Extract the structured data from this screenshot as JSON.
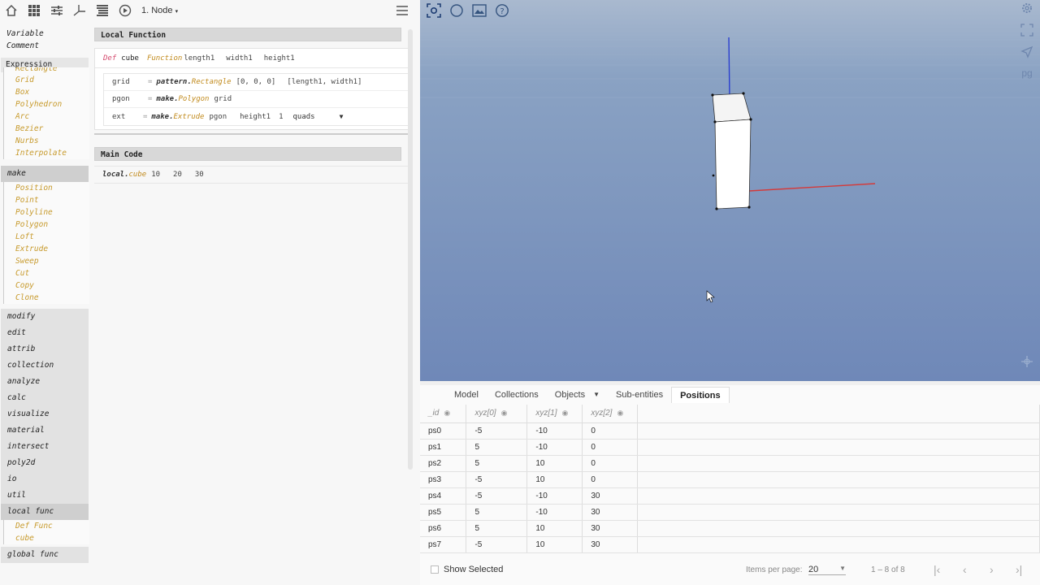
{
  "toolbar": {
    "node_label": "1. Node",
    "icons": [
      "home-icon",
      "grid-icon",
      "sliders-icon",
      "axes-icon",
      "list-icon",
      "play-icon",
      "hamburger-icon"
    ]
  },
  "sidebar": {
    "top_items": [
      "Variable",
      "Comment"
    ],
    "expression_label": "Expression",
    "pattern_items": [
      "Rectangle",
      "Grid",
      "Box",
      "Polyhedron",
      "Arc",
      "Bezier",
      "Nurbs",
      "Interpolate"
    ],
    "make_label": "make",
    "make_items": [
      "Position",
      "Point",
      "Polyline",
      "Polygon",
      "Loft",
      "Extrude",
      "Sweep",
      "Cut",
      "Copy",
      "Clone"
    ],
    "categories": [
      "modify",
      "edit",
      "attrib",
      "collection",
      "analyze",
      "calc",
      "visualize",
      "material",
      "intersect",
      "poly2d",
      "io",
      "util"
    ],
    "local_func_label": "local func",
    "local_func_items": [
      "Def Func",
      "cube"
    ],
    "global_func_label": "global func"
  },
  "editor": {
    "local_function_title": "Local Function",
    "def_keyword": "Def",
    "def_name": "cube",
    "function_keyword": "Function",
    "params": [
      "length1",
      "width1",
      "height1"
    ],
    "lines": {
      "grid_var": "grid",
      "grid_eq": "=",
      "grid_obj": "pattern.",
      "grid_fn": "Rectangle",
      "grid_arg1": "[0, 0, 0]",
      "grid_arg2": "[length1, width1]",
      "pgon_var": "pgon",
      "pgon_eq": "=",
      "pgon_obj": "make.",
      "pgon_fn": "Polygon",
      "pgon_arg1": "grid",
      "ext_var": "ext",
      "ext_eq": "=",
      "ext_obj": "make.",
      "ext_fn": "Extrude",
      "ext_arg1": "pgon",
      "ext_arg2": "height1",
      "ext_arg3": "1",
      "ext_select": "quads"
    },
    "main_code_title": "Main Code",
    "main_obj": "local.",
    "main_fn": "cube",
    "main_args": [
      "10",
      "20",
      "30"
    ]
  },
  "viewport": {
    "left_icons": [
      "focus-icon",
      "circle-icon",
      "image-icon",
      "help-icon"
    ],
    "right_label": "pg"
  },
  "panel": {
    "tabs": [
      "Model",
      "Collections",
      "Objects",
      "Sub-entities",
      "Positions"
    ],
    "active_tab": "Positions",
    "headers": [
      "_id",
      "xyz[0]",
      "xyz[1]",
      "xyz[2]"
    ],
    "rows": [
      [
        "ps0",
        "-5",
        "-10",
        "0"
      ],
      [
        "ps1",
        "5",
        "-10",
        "0"
      ],
      [
        "ps2",
        "5",
        "10",
        "0"
      ],
      [
        "ps3",
        "-5",
        "10",
        "0"
      ],
      [
        "ps4",
        "-5",
        "-10",
        "30"
      ],
      [
        "ps5",
        "5",
        "-10",
        "30"
      ],
      [
        "ps6",
        "5",
        "10",
        "30"
      ],
      [
        "ps7",
        "-5",
        "10",
        "30"
      ]
    ],
    "show_selected_label": "Show Selected",
    "items_per_page_label": "Items per page:",
    "items_per_page": "20",
    "range_label": "1 – 8 of 8"
  }
}
